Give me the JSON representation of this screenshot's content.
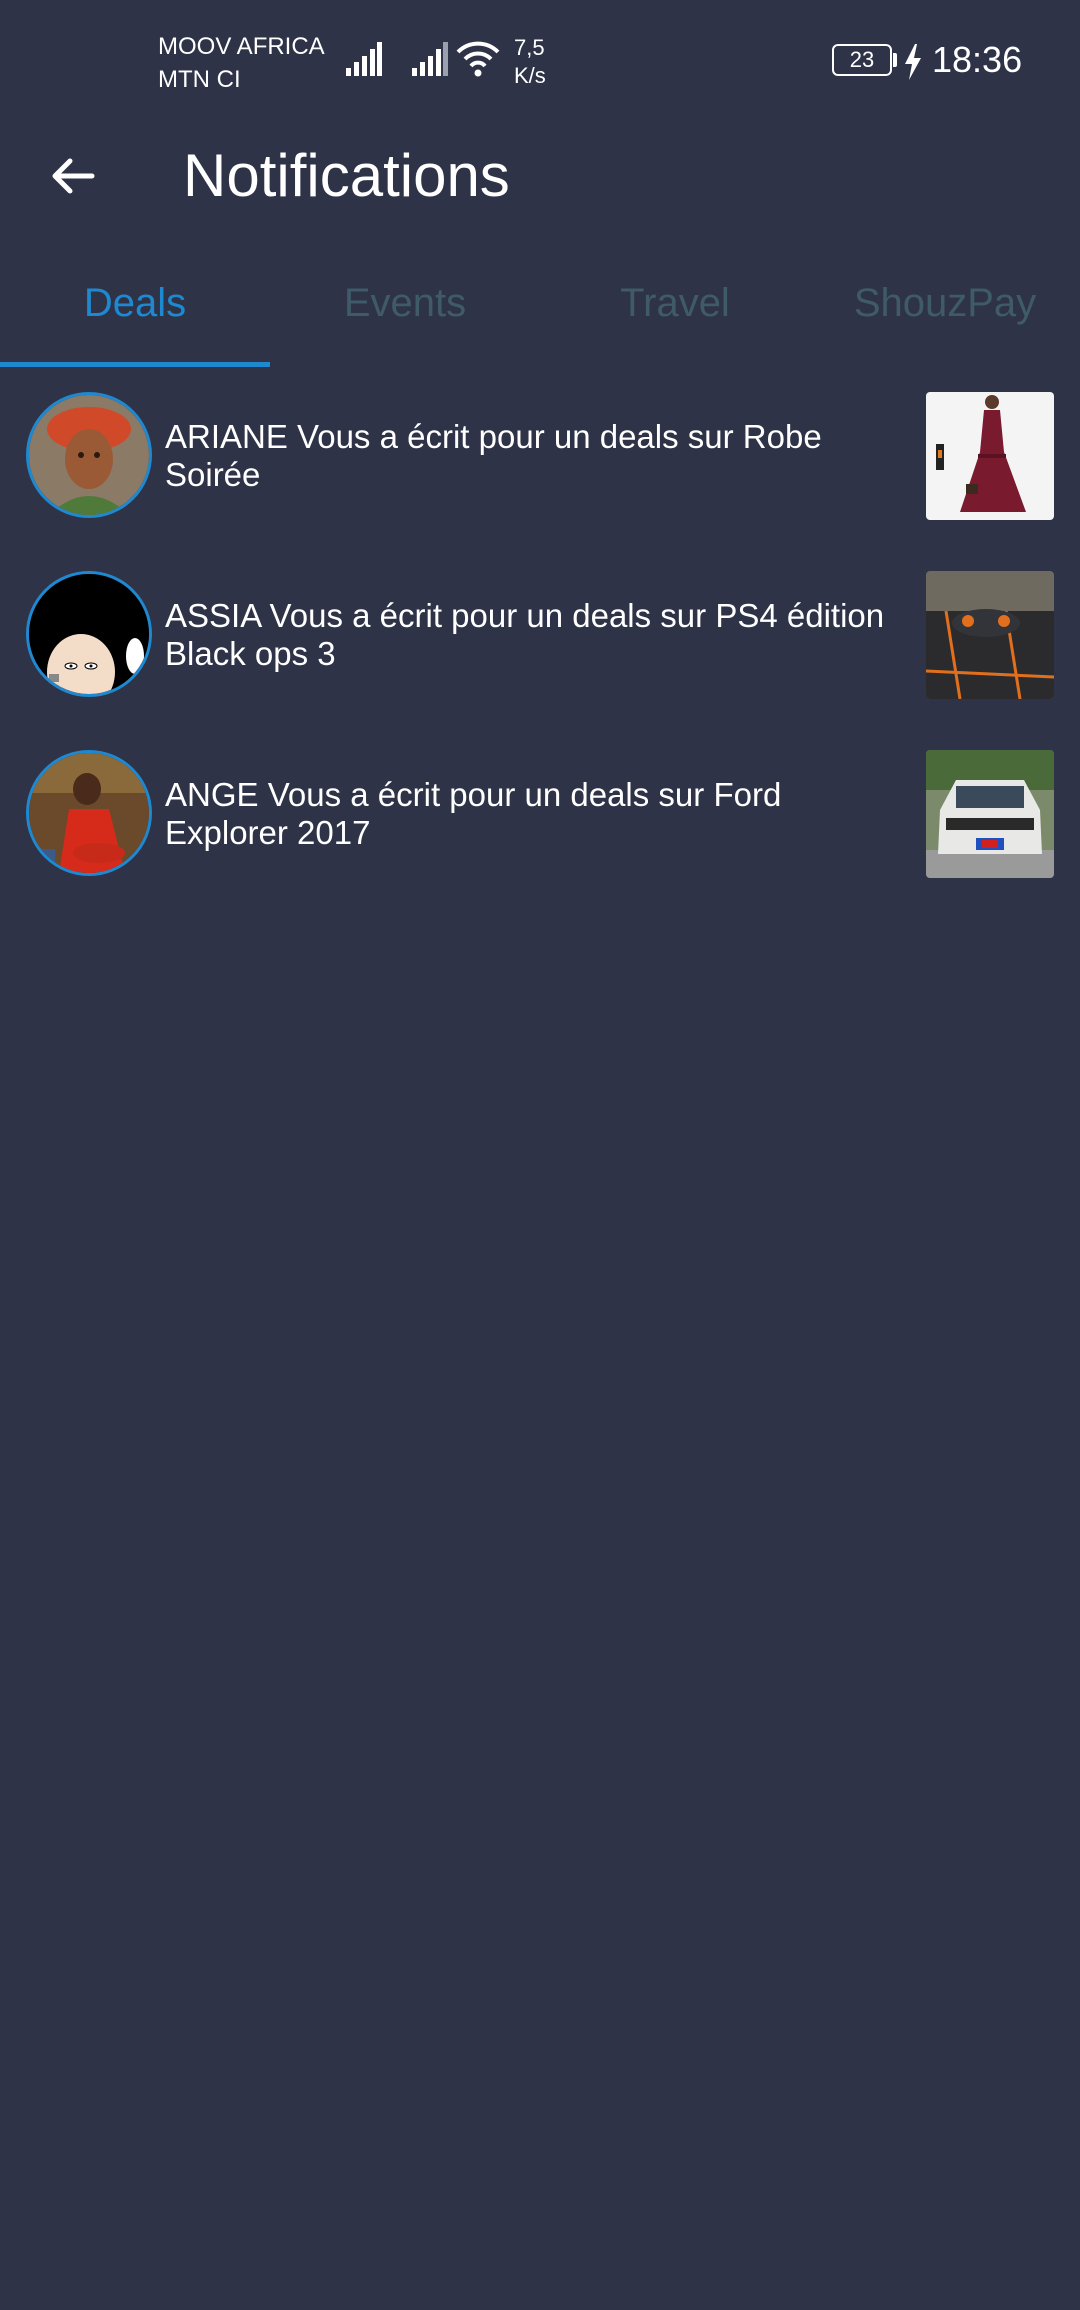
{
  "status_bar": {
    "carrier_1": "MOOV AFRICA",
    "carrier_2": "MTN CI",
    "speed_value": "7,5",
    "speed_unit": "K/s",
    "battery_level": "23",
    "time": "18:36",
    "icons": [
      "signal-icon",
      "signal-icon",
      "wifi-icon",
      "battery-icon",
      "charging-icon"
    ]
  },
  "app_bar": {
    "back_icon": "arrow-left-icon",
    "title": "Notifications"
  },
  "tabs": [
    {
      "label": "Deals",
      "active": true
    },
    {
      "label": "Events",
      "active": false
    },
    {
      "label": "Travel",
      "active": false
    },
    {
      "label": "ShouzPay",
      "active": false
    }
  ],
  "notifications": [
    {
      "text": "ARIANE Vous a écrit pour un deals sur Robe Soirée"
    },
    {
      "text": "ASSIA Vous a écrit pour un deals sur PS4 édition Black ops 3"
    },
    {
      "text": "ANGE Vous a écrit pour un deals sur Ford Explorer 2017"
    }
  ],
  "colors": {
    "background": "#2e3347",
    "accent": "#1e88d1",
    "inactive_tab": "#3f5a69",
    "text": "#ffffff"
  }
}
